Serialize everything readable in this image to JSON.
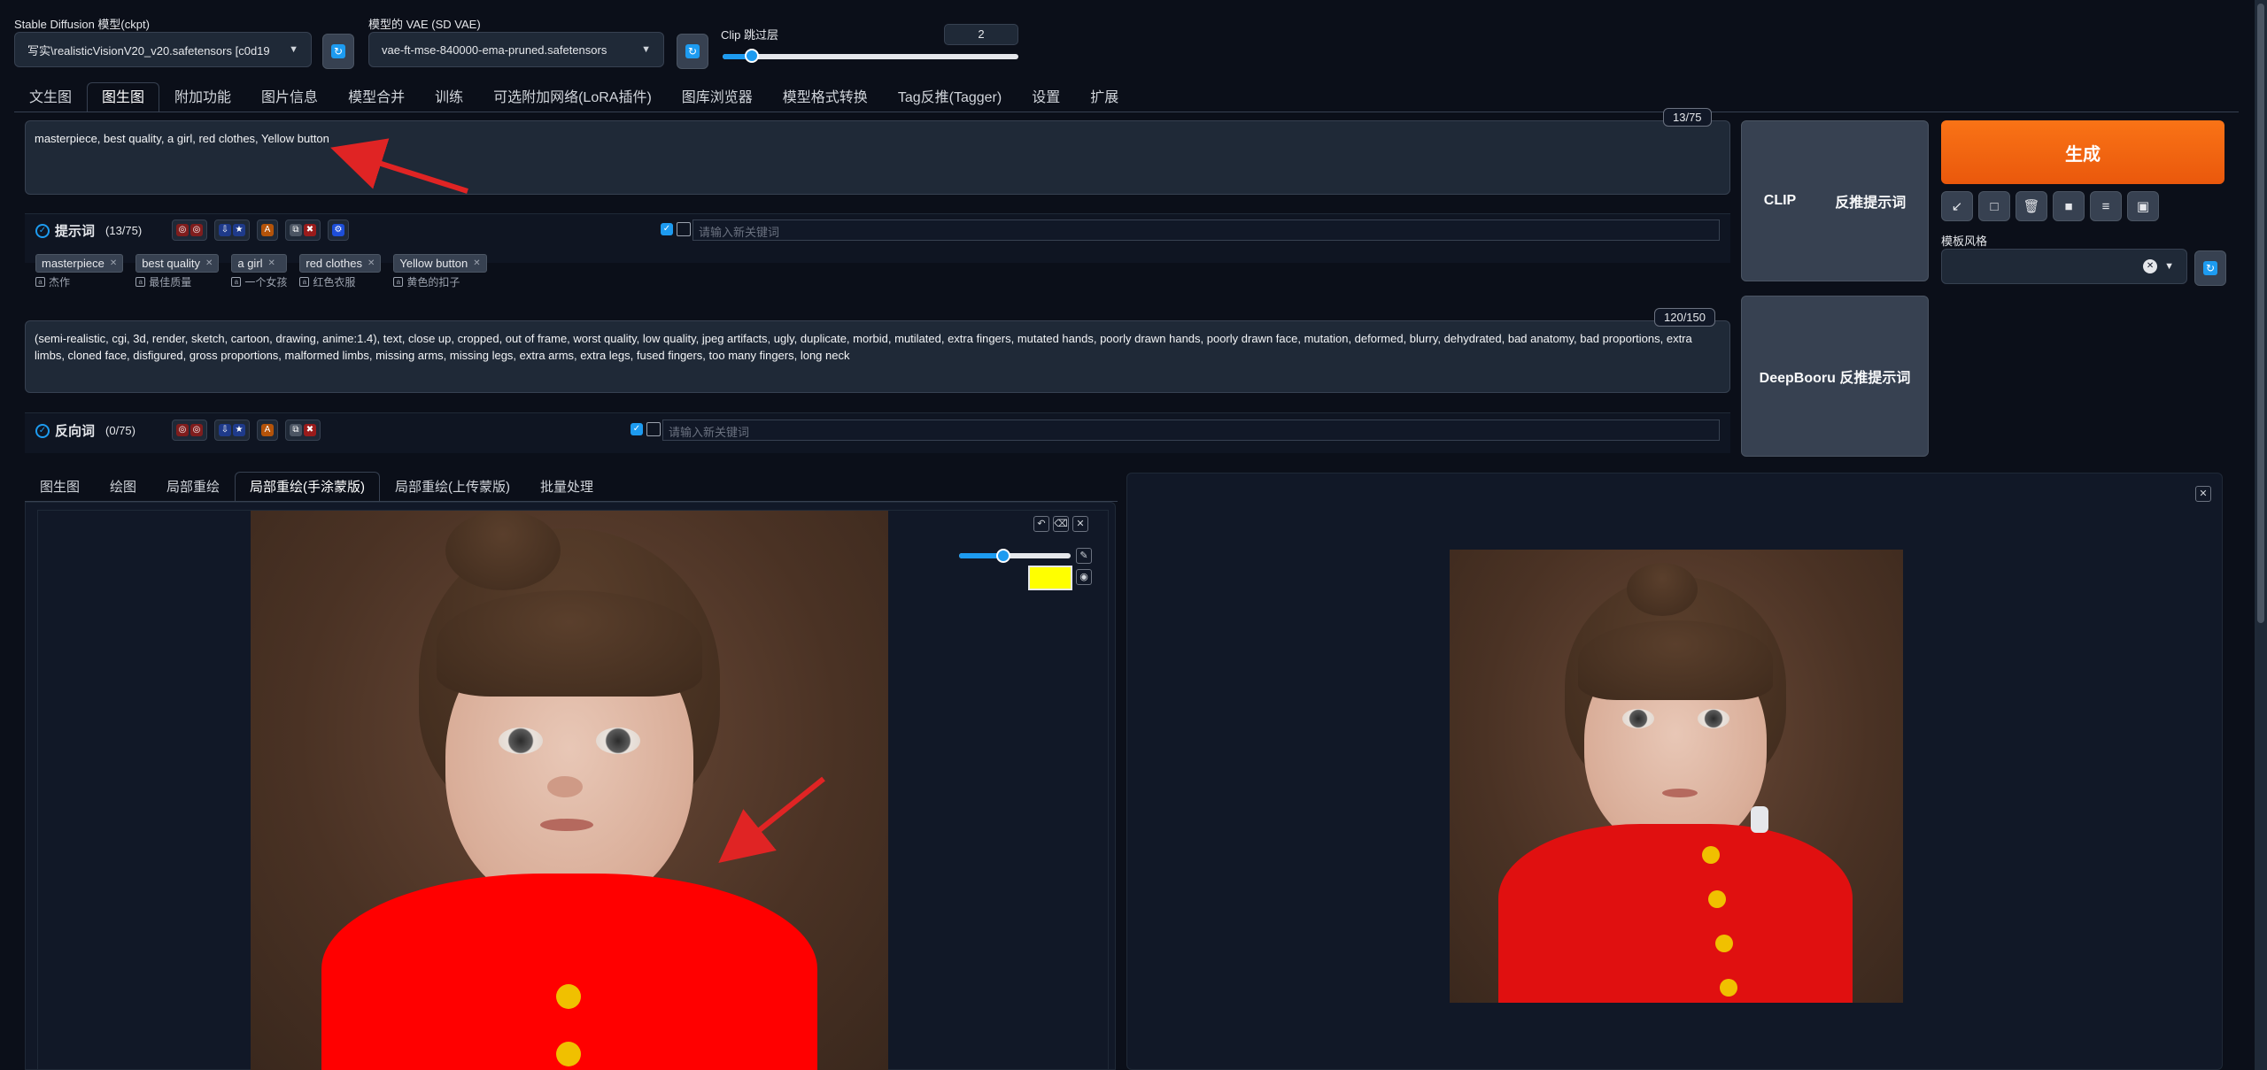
{
  "top": {
    "model_label": "Stable Diffusion 模型(ckpt)",
    "model_value": "写实\\realisticVisionV20_v20.safetensors [c0d19",
    "vae_label": "模型的 VAE (SD VAE)",
    "vae_value": "vae-ft-mse-840000-ema-pruned.safetensors",
    "clip_label": "Clip 跳过层",
    "clip_value": "2",
    "clip_level": 0.1
  },
  "main_tabs": [
    "文生图",
    "图生图",
    "附加功能",
    "图片信息",
    "模型合并",
    "训练",
    "可选附加网络(LoRA插件)",
    "图库浏览器",
    "模型格式转换",
    "Tag反推(Tagger)",
    "设置",
    "扩展"
  ],
  "main_tab_active": 1,
  "prompt": {
    "text": "masterpiece, best quality, a girl, red clothes, Yellow button",
    "counter": "13/75",
    "section_label": "提示词",
    "section_count": "(13/75)",
    "keyword_placeholder": "请输入新关键词",
    "tags": [
      {
        "en": "masterpiece",
        "zh": "杰作"
      },
      {
        "en": "best quality",
        "zh": "最佳质量"
      },
      {
        "en": "a girl",
        "zh": "一个女孩"
      },
      {
        "en": "red clothes",
        "zh": "红色衣服"
      },
      {
        "en": "Yellow button",
        "zh": "黄色的扣子"
      }
    ]
  },
  "negative": {
    "text": "(semi-realistic, cgi, 3d, render, sketch, cartoon, drawing, anime:1.4), text, close up, cropped, out of frame, worst quality, low quality, jpeg artifacts, ugly, duplicate, morbid, mutilated, extra fingers, mutated hands, poorly drawn hands, poorly drawn face, mutation, deformed, blurry, dehydrated, bad anatomy, bad proportions, extra limbs, cloned face, disfigured, gross proportions, malformed limbs, missing arms, missing legs, extra arms, extra legs, fused fingers, too many fingers, long neck",
    "counter": "120/150",
    "section_label": "反向词",
    "section_count": "(0/75)",
    "keyword_placeholder": "请输入新关键词"
  },
  "interrogate": {
    "clip_label": "CLIP",
    "clip_action": "反推提示词",
    "deepbooru_label": "DeepBooru 反推提示词"
  },
  "generate": {
    "label": "生成",
    "style_label": "模板风格",
    "tool_icons": [
      "↙",
      "□",
      "🗑",
      "■",
      "≡",
      "▣"
    ]
  },
  "img2img_tabs": [
    "图生图",
    "绘图",
    "局部重绘",
    "局部重绘(手涂蒙版)",
    "局部重绘(上传蒙版)",
    "批量处理"
  ],
  "img2img_tab_active": 3,
  "brush": {
    "color": "#ffff00",
    "size_level": 0.4
  },
  "colors": {
    "accent": "#1d9bf0",
    "generate": "#f97316",
    "background": "#0b0f19",
    "arrow": "#e02424",
    "mask": "#ff0000"
  }
}
